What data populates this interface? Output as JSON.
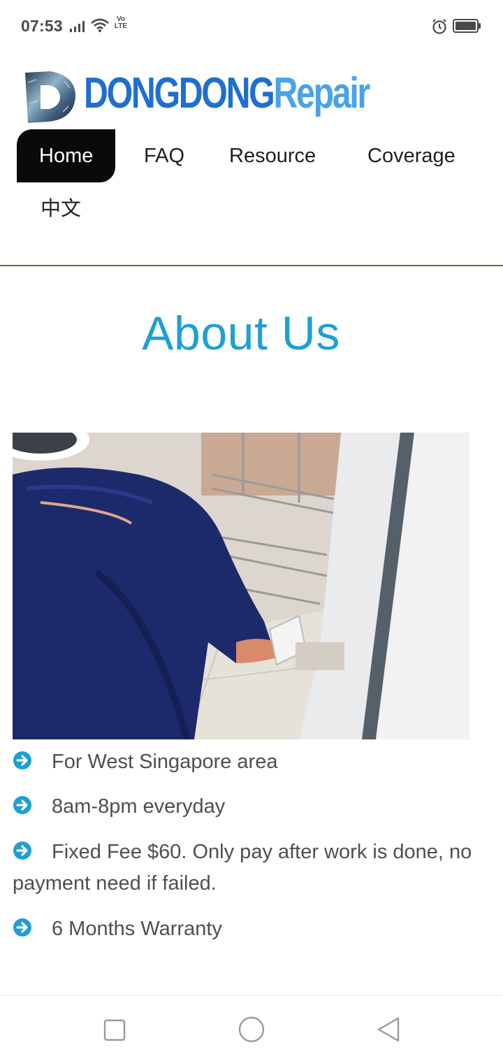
{
  "status_bar": {
    "time": "07:53",
    "volte_top": "Vo",
    "volte_bottom": "LTE",
    "icons": [
      "signal-icon",
      "wifi-icon",
      "alarm-icon",
      "battery-icon"
    ]
  },
  "header": {
    "logo_text_part1": "DONGDONG",
    "logo_text_part2": "Repair",
    "brand_colors": {
      "primary": "#1e6fce",
      "secondary": "#4aa3ea"
    }
  },
  "nav": {
    "items": [
      {
        "label": "Home",
        "active": true
      },
      {
        "label": "FAQ",
        "active": false
      },
      {
        "label": "Resource",
        "active": false
      },
      {
        "label": "Coverage",
        "active": false
      },
      {
        "label": "中文",
        "active": false
      }
    ]
  },
  "main": {
    "title": "About Us",
    "title_color": "#1f9fd4",
    "features": [
      {
        "icon": "arrow-circle-right-icon",
        "text": "For West Singapore area"
      },
      {
        "icon": "arrow-circle-right-icon",
        "text": "8am-8pm everyday"
      },
      {
        "icon": "arrow-circle-right-icon",
        "text": "Fixed Fee $60. Only pay after work is done, no payment need if failed."
      },
      {
        "icon": "arrow-circle-right-icon",
        "text": "6 Months Warranty"
      }
    ]
  },
  "system_nav": {
    "buttons": [
      "recent-apps-icon",
      "home-circle-icon",
      "back-triangle-icon"
    ]
  }
}
